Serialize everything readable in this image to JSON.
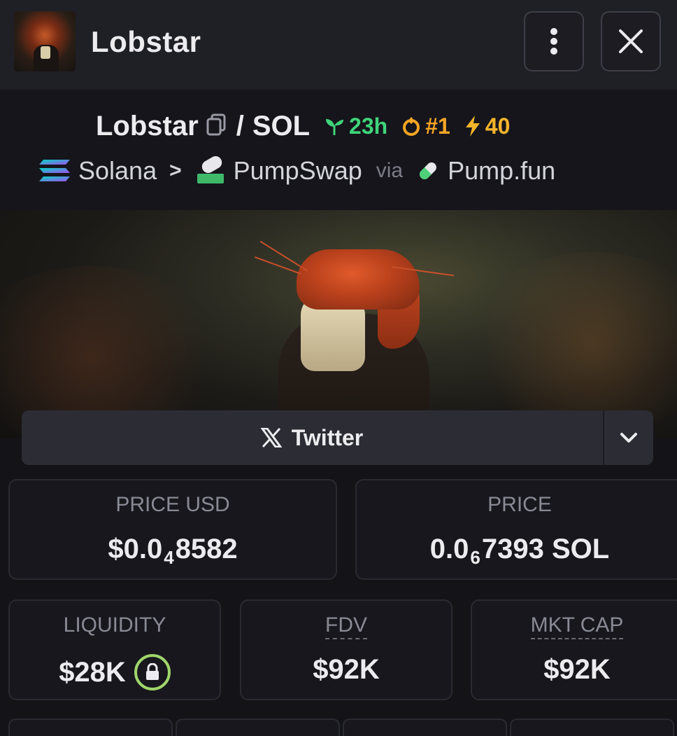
{
  "header": {
    "title": "Lobstar",
    "more_icon": "vertical-dots-icon",
    "close_icon": "close-icon"
  },
  "pair": {
    "base": "Lobstar",
    "separator": "/",
    "quote": "SOL",
    "age": "23h",
    "rank": "#1",
    "boosts": "40",
    "chain": "Solana",
    "dex": "PumpSwap",
    "via_label": "via",
    "launchpad": "Pump.fun"
  },
  "social": {
    "twitter_label": "Twitter"
  },
  "stats": {
    "price_usd_label": "PRICE USD",
    "price_usd_prefix": "$0.0",
    "price_usd_zeros": "4",
    "price_usd_digits": "8582",
    "price_label": "PRICE",
    "price_prefix": "0.0",
    "price_zeros": "6",
    "price_digits": "7393 SOL",
    "liquidity_label": "LIQUIDITY",
    "liquidity_value": "$28K",
    "fdv_label": "FDV",
    "fdv_value": "$92K",
    "mcap_label": "MKT CAP",
    "mcap_value": "$92K"
  },
  "colors": {
    "age_green": "#3fd47a",
    "rank_orange": "#f5a524",
    "lock_green": "#9fd66b"
  }
}
